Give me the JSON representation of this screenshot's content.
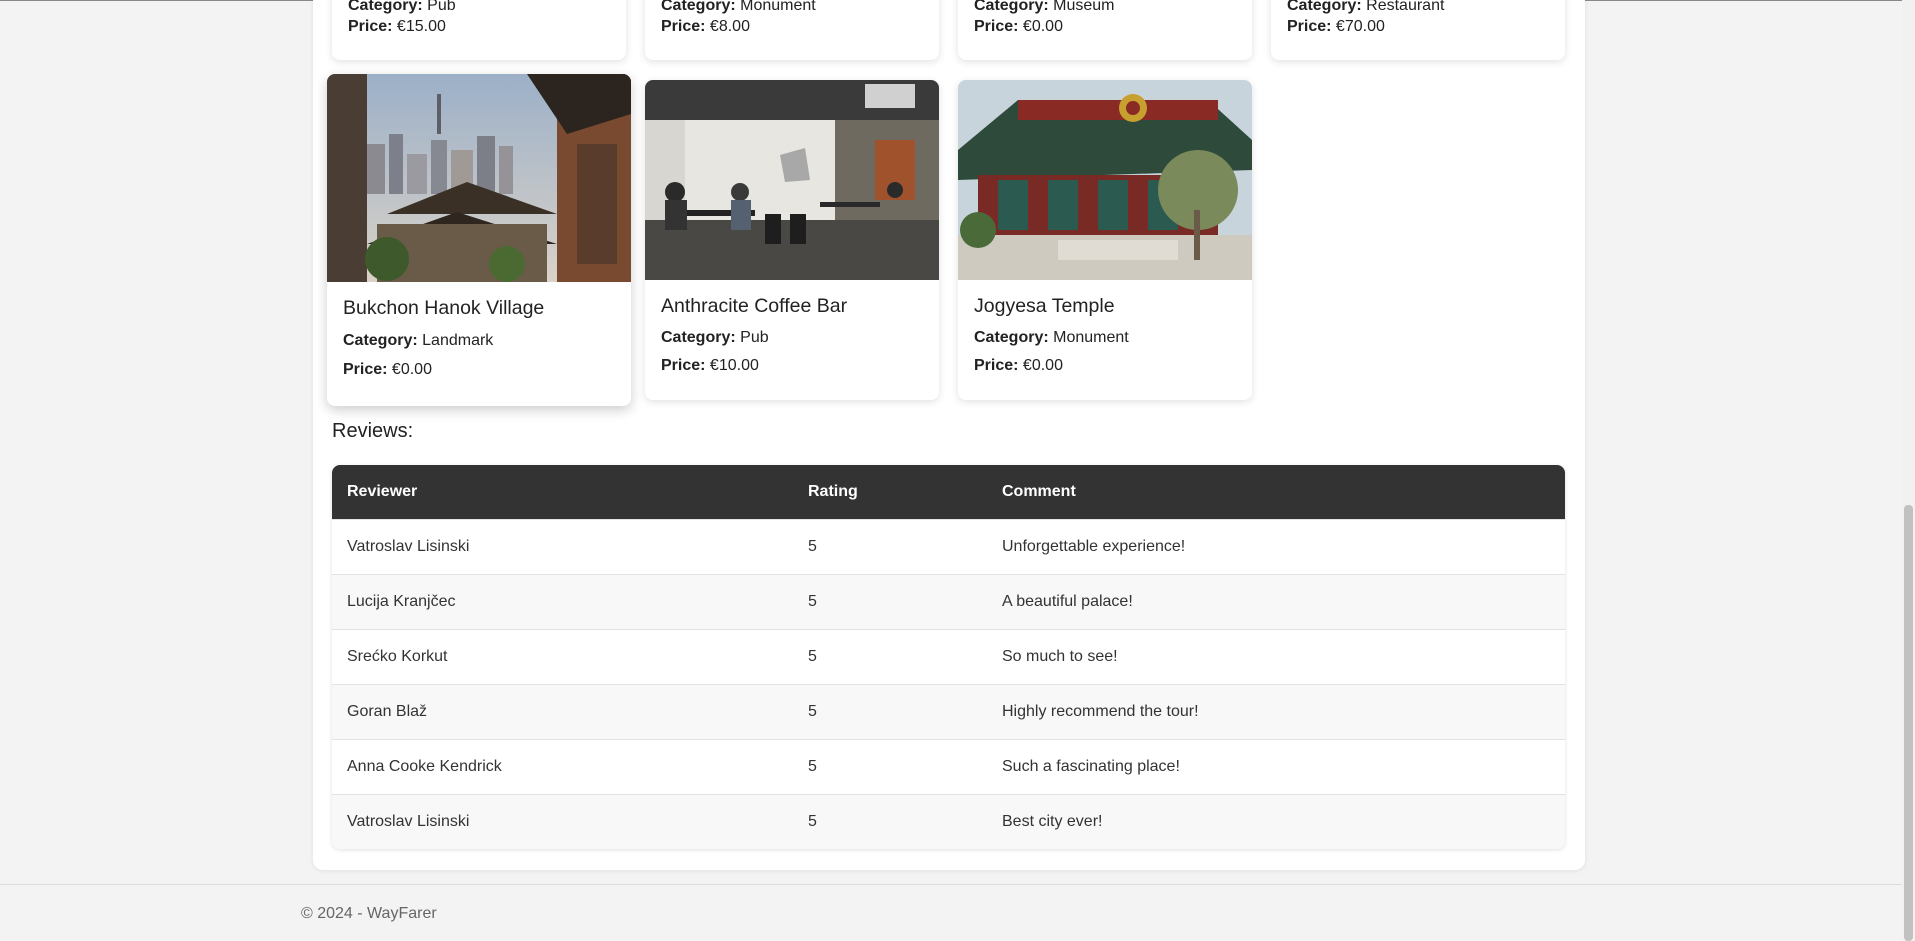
{
  "top_cards": [
    {
      "category_label": "Category:",
      "category": "Pub",
      "price_label": "Price:",
      "price": "€15.00"
    },
    {
      "category_label": "Category:",
      "category": "Monument",
      "price_label": "Price:",
      "price": "€8.00"
    },
    {
      "category_label": "Category:",
      "category": "Museum",
      "price_label": "Price:",
      "price": "€0.00"
    },
    {
      "category_label": "Category:",
      "category": "Restaurant",
      "price_label": "Price:",
      "price": "€70.00"
    }
  ],
  "cards": [
    {
      "name": "Bukchon Hanok Village",
      "category_label": "Category:",
      "category": "Landmark",
      "price_label": "Price:",
      "price": "€0.00"
    },
    {
      "name": "Anthracite Coffee Bar",
      "category_label": "Category:",
      "category": "Pub",
      "price_label": "Price:",
      "price": "€10.00"
    },
    {
      "name": "Jogyesa Temple",
      "category_label": "Category:",
      "category": "Monument",
      "price_label": "Price:",
      "price": "€0.00"
    }
  ],
  "reviews": {
    "title": "Reviews:",
    "headers": [
      "Reviewer",
      "Rating",
      "Comment"
    ],
    "rows": [
      [
        "Vatroslav Lisinski",
        "5",
        "Unforgettable experience!"
      ],
      [
        "Lucija Kranjčec",
        "5",
        "A beautiful palace!"
      ],
      [
        "Srećko Korkut",
        "5",
        "So much to see!"
      ],
      [
        "Goran Blaž",
        "5",
        "Highly recommend the tour!"
      ],
      [
        "Anna Cooke Kendrick",
        "5",
        "Such a fascinating place!"
      ],
      [
        "Vatroslav Lisinski",
        "5",
        "Best city ever!"
      ]
    ]
  },
  "footer": {
    "text": "© 2024 - WayFarer"
  },
  "colors": {
    "table_header": "#333333",
    "panel": "#ffffff",
    "page_bg": "#f3f3f3"
  }
}
